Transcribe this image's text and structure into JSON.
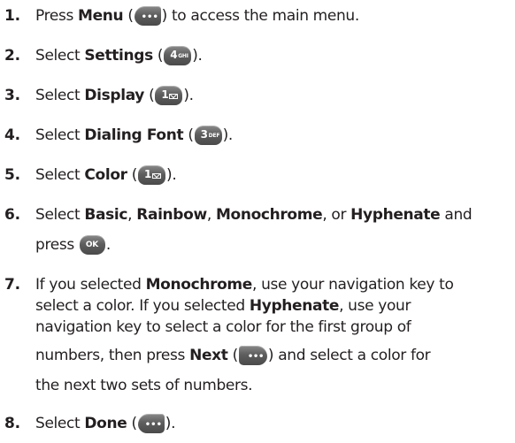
{
  "steps": [
    {
      "number": "1.",
      "lines": [
        {
          "pre": "Press ",
          "bold": "Menu",
          "mid": " (",
          "key": "menu-soft-key",
          "post": ") to access the main menu."
        }
      ]
    },
    {
      "number": "2.",
      "lines": [
        {
          "pre": "Select ",
          "bold": "Settings",
          "mid": " (",
          "key": "number-4-key",
          "key_digit": "4",
          "key_letters": "GHI",
          "post": ")."
        }
      ]
    },
    {
      "number": "3.",
      "lines": [
        {
          "pre": "Select ",
          "bold": "Display",
          "mid": " (",
          "key": "number-1-key",
          "key_digit": "1",
          "post": ")."
        }
      ]
    },
    {
      "number": "4.",
      "lines": [
        {
          "pre": "Select ",
          "bold": "Dialing Font",
          "mid": " (",
          "key": "number-3-key",
          "key_digit": "3",
          "key_letters": "DEF",
          "post": ")."
        }
      ]
    },
    {
      "number": "5.",
      "lines": [
        {
          "pre": "Select ",
          "bold": "Color",
          "mid": " (",
          "key": "number-1-key",
          "key_digit": "1",
          "post": ")."
        }
      ]
    },
    {
      "number": "6.",
      "line1": {
        "t1": "Select ",
        "b1": "Basic",
        "t2": ", ",
        "b2": "Rainbow",
        "t3": ", ",
        "b3": "Monochrome",
        "t4": ", or ",
        "b4": "Hyphenate",
        "t5": " and"
      },
      "line2": {
        "pre": "press ",
        "key_label": "OK",
        "post": "."
      }
    },
    {
      "number": "7.",
      "line1": {
        "t1": "If you selected ",
        "b1": "Monochrome",
        "t2": ", use your navigation key to"
      },
      "line2": {
        "t1": "select a color. If you selected ",
        "b1": "Hyphenate",
        "t2": ", use your"
      },
      "line3": {
        "t1": "navigation key to select a color for the first group of"
      },
      "line4": {
        "t1": "numbers, then press ",
        "b1": "Next",
        "t2": " (",
        "t3": ") and select a color for"
      },
      "line5": {
        "t1": "the next two sets of numbers."
      }
    },
    {
      "number": "8.",
      "lines": [
        {
          "pre": "Select ",
          "bold": "Done",
          "mid": " (",
          "key": "done-soft-key",
          "post": ")."
        }
      ]
    }
  ],
  "icons": {
    "soft_key_glyph": "•••",
    "ok_key_label": "OK",
    "key_color": "#5e5e5e"
  }
}
